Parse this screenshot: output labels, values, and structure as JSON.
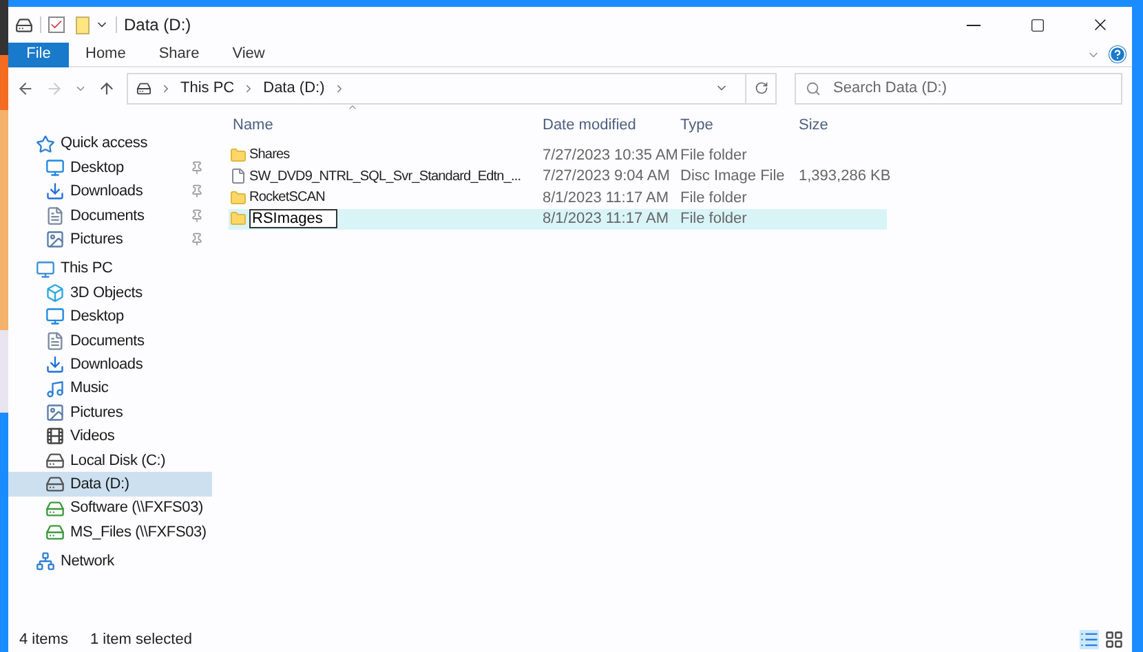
{
  "window": {
    "title": "Data (D:)"
  },
  "ribbon_tabs": [
    {
      "label": "File",
      "selected": true
    },
    {
      "label": "Home",
      "selected": false
    },
    {
      "label": "Share",
      "selected": false
    },
    {
      "label": "View",
      "selected": false
    }
  ],
  "address": {
    "crumbs": [
      "This PC",
      "Data (D:)"
    ]
  },
  "search": {
    "placeholder": "Search Data (D:)"
  },
  "sidebar": {
    "items": [
      {
        "label": "Quick access",
        "kind": "star",
        "selected": false,
        "children": [
          {
            "label": "Desktop",
            "kind": "desktop",
            "pinned": true,
            "selected": false
          },
          {
            "label": "Downloads",
            "kind": "download",
            "pinned": true,
            "selected": false
          },
          {
            "label": "Documents",
            "kind": "document",
            "pinned": true,
            "selected": false
          },
          {
            "label": "Pictures",
            "kind": "picture",
            "pinned": true,
            "selected": false
          }
        ]
      },
      {
        "label": "This PC",
        "kind": "pc",
        "selected": false,
        "children": [
          {
            "label": "3D Objects",
            "kind": "cube",
            "selected": false
          },
          {
            "label": "Desktop",
            "kind": "desktop",
            "selected": false
          },
          {
            "label": "Documents",
            "kind": "document",
            "selected": false
          },
          {
            "label": "Downloads",
            "kind": "download",
            "selected": false
          },
          {
            "label": "Music",
            "kind": "music",
            "selected": false
          },
          {
            "label": "Pictures",
            "kind": "picture",
            "selected": false
          },
          {
            "label": "Videos",
            "kind": "video",
            "selected": false
          },
          {
            "label": "Local Disk (C:)",
            "kind": "drive",
            "selected": false
          },
          {
            "label": "Data (D:)",
            "kind": "drive",
            "selected": true
          },
          {
            "label": "Software (\\\\FXFS03)",
            "kind": "netdrive",
            "selected": false
          },
          {
            "label": "MS_Files (\\\\FXFS03)",
            "kind": "netdrive",
            "selected": false
          }
        ]
      },
      {
        "label": "Network",
        "kind": "network",
        "selected": false
      }
    ]
  },
  "table": {
    "columns": [
      "Name",
      "Date modified",
      "Type",
      "Size"
    ],
    "rows": [
      {
        "name": "Shares",
        "kind": "folder",
        "date": "7/27/2023 10:35 AM",
        "type": "File folder",
        "selected": false
      },
      {
        "name": "SW_DVD9_NTRL_SQL_Svr_Standard_Edtn_...",
        "kind": "file",
        "date": "7/27/2023 9:04 AM",
        "type": "Disc Image File",
        "size": "1,393,286 KB",
        "selected": false
      },
      {
        "name": "RocketSCAN",
        "kind": "folder",
        "date": "8/1/2023 11:17 AM",
        "type": "File folder",
        "selected": false
      },
      {
        "name": "RSImages",
        "kind": "folder",
        "date": "8/1/2023 11:17 AM",
        "type": "File folder",
        "selected": true,
        "renaming": true
      }
    ]
  },
  "status_bar": {
    "count": "4 items",
    "selection": "1 item selected"
  }
}
